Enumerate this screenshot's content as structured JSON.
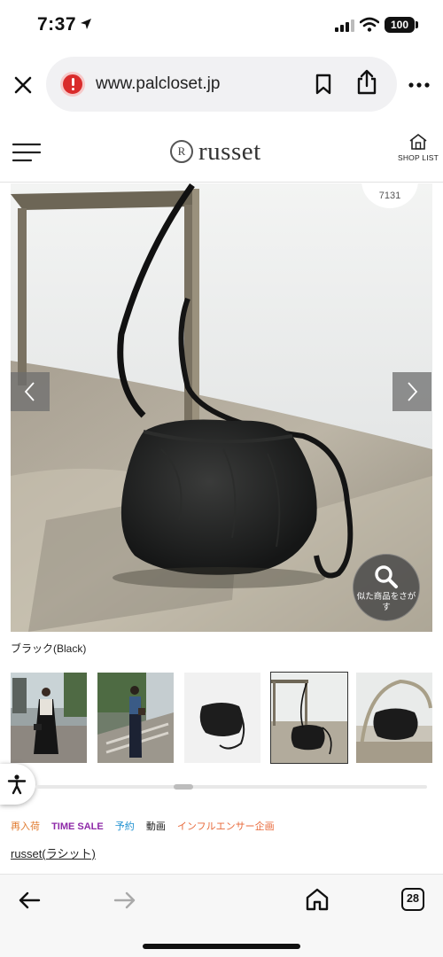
{
  "status_bar": {
    "time": "7:37",
    "battery": "100"
  },
  "browser": {
    "url": "www.palcloset.jp"
  },
  "site": {
    "brand": "russet",
    "shop_list_label": "SHOP LIST"
  },
  "gallery": {
    "count": "7131",
    "similar_search_label": "似た商品をさがす",
    "color_name": "ブラック(Black)",
    "thumbnail_count": 5,
    "selected_thumbnail": 4
  },
  "tags": [
    "再入荷",
    "TIME SALE",
    "予約",
    "動画",
    "インフルエンサー企画"
  ],
  "brand_link": "russet(ラシット)",
  "toolbar": {
    "tab_count": "28"
  },
  "colors": {
    "time_sale": "#8e2aa8",
    "restock": "#e07a2e",
    "reserve": "#1c8fd0",
    "influencer": "#e86a3b",
    "site_badge": "#d92b2b"
  }
}
